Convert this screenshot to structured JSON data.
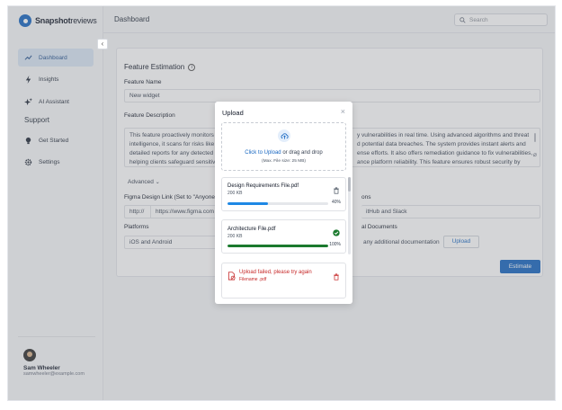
{
  "app": {
    "logo_bold": "Snapshot",
    "logo_thin": "reviews",
    "page_title": "Dashboard"
  },
  "search": {
    "placeholder": "Search"
  },
  "sidebar": {
    "items": [
      {
        "label": "Dashboard",
        "icon": "trend-icon",
        "active": true
      },
      {
        "label": "Insights",
        "icon": "bolt-icon"
      },
      {
        "label": "AI Assistant",
        "icon": "sparkle-icon"
      }
    ],
    "support_heading": "Support",
    "support_items": [
      {
        "label": "Get Started",
        "icon": "bulb-icon"
      },
      {
        "label": "Settings",
        "icon": "gear-icon"
      }
    ],
    "collapse_glyph": "‹"
  },
  "user": {
    "name": "Sam Wheeler",
    "email": "samwheeler@example.com"
  },
  "form": {
    "title": "Feature Estimation",
    "name_label": "Feature Name",
    "name_value": "New widget",
    "desc_label": "Feature Description",
    "desc_left": "This feature proactively monitors c\nintelligence, it scans for risks like r\ndetailed reports for any detected i\nhelping clients safeguard sensitive",
    "desc_right": "y vulnerabilities in real time. Using advanced algorithms and threat\nd potential data breaches. The system provides instant alerts and\nense efforts. It also offers remediation guidance to fix vulnerabilities,\nance platform reliability. This feature ensures robust security by",
    "advanced_label": "Advanced",
    "figma_label": "Figma Design Link (Set to \"Anyone c",
    "figma_prefix": "http://",
    "figma_value": "https://www.figma.com",
    "integrations_label_tail": "ons",
    "integrations_value_tail": "itHub and Slack",
    "platforms_label": "Platforms",
    "platforms_value": "iOS and Android",
    "docs_label_tail": "al Documents",
    "docs_value_tail": "any additional documentation",
    "upload_button": "Upload",
    "estimate_button": "Estimate"
  },
  "modal": {
    "title": "Upload",
    "close": "×",
    "drop_link": "Click to Upload",
    "drop_text": " or drag and drop",
    "drop_hint": "(Max. File size: 25 MB)",
    "files": [
      {
        "name": "Design Requirements File.pdf",
        "size": "200 KB",
        "progress": 40,
        "progress_label": "40%",
        "status": "uploading",
        "bar_color": "#1e88e5"
      },
      {
        "name": "Architecture File.pdf",
        "size": "200 KB",
        "progress": 100,
        "progress_label": "100%",
        "status": "done",
        "bar_color": "#1b7a2e"
      }
    ],
    "error": {
      "message": "Upload failed, please try again",
      "filename": "Filename .pdf"
    }
  },
  "colors": {
    "accent": "#1565c0",
    "success": "#1b7a2e",
    "error": "#c62828"
  }
}
